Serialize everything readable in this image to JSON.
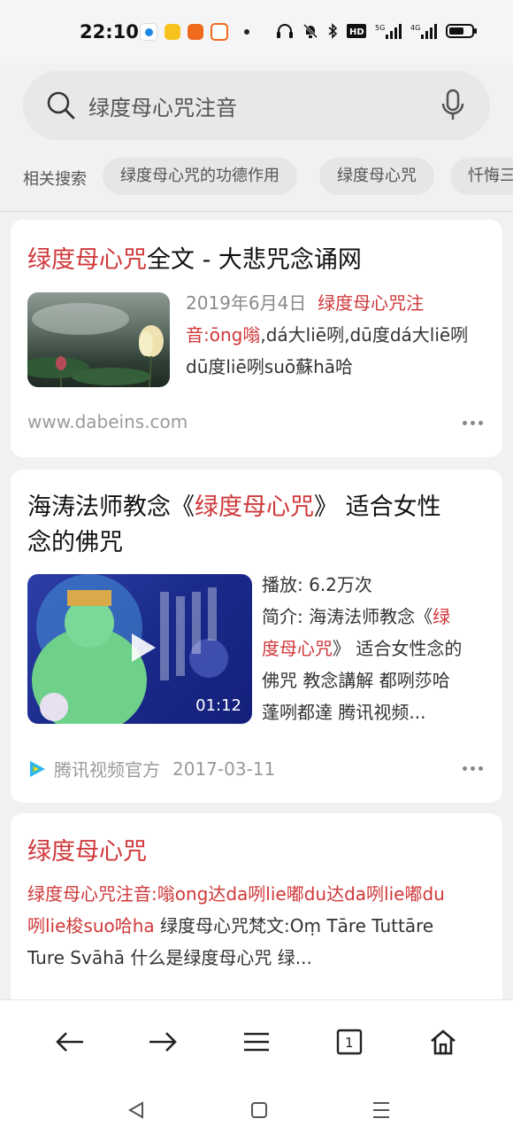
{
  "status_bar": {
    "time": "22:10"
  },
  "search": {
    "query": "绿度母心咒注音"
  },
  "related": {
    "label": "相关搜索",
    "chips": [
      "绿度母心咒的功德作用",
      "绿度母心咒",
      "忏悔三"
    ]
  },
  "results": [
    {
      "title_hl": "绿度母心咒",
      "title_rest": "全文 - 大悲咒念诵网",
      "date": "2019年6月4日",
      "snippet_hl1": "绿度母心咒注",
      "snippet_hl2": "音:ōng嗡",
      "snippet_rest1": ",dá大liē咧,dū度dá大liē咧",
      "snippet_rest2": "dū度liē咧suō蘇hā哈",
      "source": "www.dabeins.com"
    },
    {
      "title_pre": "海涛法师教念《",
      "title_hl": "绿度母心咒",
      "title_post": "》 适合女性",
      "title_line2": "念的佛咒",
      "plays": "播放:  6.2万次",
      "intro_pre": "简介:  海涛法师教念《",
      "intro_hl1": "绿",
      "intro_hl2": "度母心咒",
      "intro_post": "》 适合女性念的",
      "intro_line3": "佛咒 教念講解 都咧莎哈",
      "intro_line4": "蓬咧都達 腾讯视频...",
      "duration": "01:12",
      "source": "腾讯视频官方",
      "source_date": "2017-03-11"
    },
    {
      "title_hl": "绿度母心咒",
      "snippet_hl_line1": "绿度母心咒注音:嗡ong达da咧lie嘟du达da咧lie嘟du",
      "snippet_hl_line2": "咧lie梭suo哈ha",
      "snippet_rest_line2": " 绿度母心咒梵文:Oṃ Tāre Tuttāre",
      "snippet_line3": "Ture Svāhā 什么是绿度母心咒 绿..."
    }
  ],
  "colors": {
    "highlight": "#d0383a",
    "background": "#f1f1f3"
  }
}
